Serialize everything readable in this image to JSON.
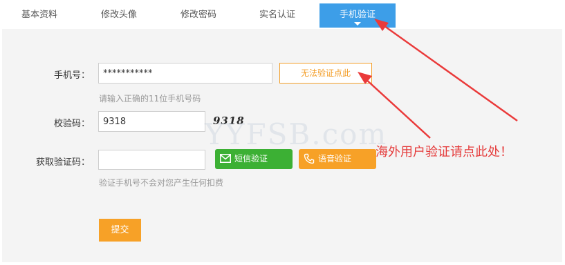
{
  "tabs": [
    {
      "label": "基本资料"
    },
    {
      "label": "修改头像"
    },
    {
      "label": "修改密码"
    },
    {
      "label": "实名认证"
    },
    {
      "label": "手机验证"
    }
  ],
  "form": {
    "phone": {
      "label": "手机号：",
      "value": "***********",
      "hint": "请输入正确的11位手机号码",
      "unable_button": "无法验证点此"
    },
    "check_code": {
      "label": "校验码：",
      "value": "9318",
      "captcha_text": "9318"
    },
    "verify_code": {
      "label": "获取验证码：",
      "value": "",
      "sms_button": "短信验证",
      "voice_button": "语音验证",
      "hint": "验证手机号不会对您产生任何扣费"
    },
    "submit_button": "提交"
  },
  "watermark": "YYFSB.com",
  "annotation": "海外用户验证请点此处！",
  "colors": {
    "tab_active": "#3d9ee8",
    "orange": "#f7a127",
    "green": "#3cb034",
    "annotation_red": "#e53b3b"
  }
}
